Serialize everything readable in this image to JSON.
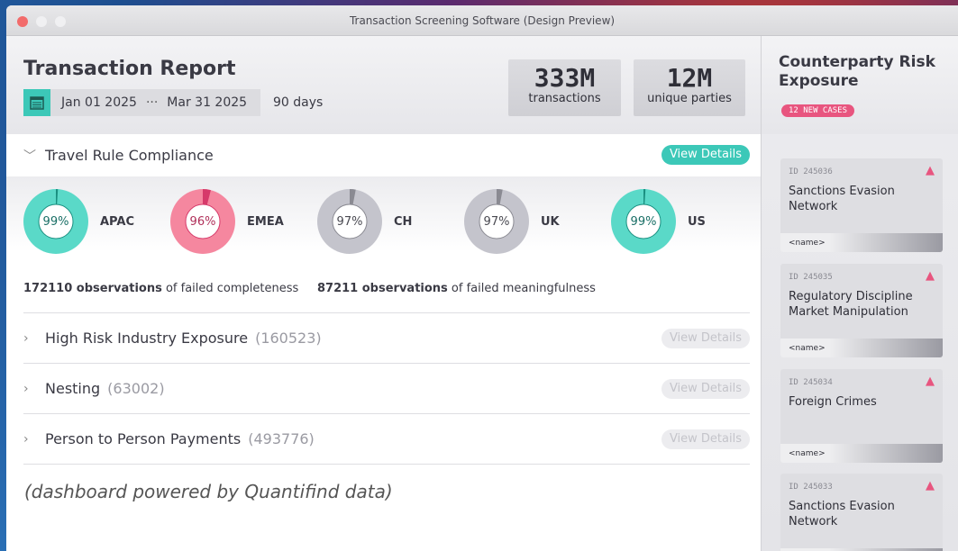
{
  "window": {
    "title": "Transaction Screening Software (Design Preview)",
    "dot_colors": [
      "#f26b6b",
      "#f0f0f2",
      "#f0f0f2"
    ]
  },
  "report": {
    "title": "Transaction Report",
    "date_start": "Jan 01 2025",
    "date_sep": "···",
    "date_end": "Mar 31 2025",
    "days": "90 days",
    "stats": [
      {
        "value": "333M",
        "label": "transactions"
      },
      {
        "value": "12M",
        "label": "unique parties"
      }
    ]
  },
  "travel": {
    "label": "Travel Rule Compliance",
    "view_label": "View Details",
    "regions": [
      {
        "name": "APAC",
        "pct": "99%",
        "value": 99,
        "fill": "#5ad9c8",
        "mark": "#1a8f80",
        "text": "#1a6f66"
      },
      {
        "name": "EMEA",
        "pct": "96%",
        "value": 96,
        "fill": "#f5879f",
        "mark": "#d63a6a",
        "text": "#b0305a"
      },
      {
        "name": "CH",
        "pct": "97%",
        "value": 97,
        "fill": "#c4c4cc",
        "mark": "#8a8a92",
        "text": "#4a4a52"
      },
      {
        "name": "UK",
        "pct": "97%",
        "value": 97,
        "fill": "#c4c4cc",
        "mark": "#8a8a92",
        "text": "#4a4a52"
      },
      {
        "name": "US",
        "pct": "99%",
        "value": 99,
        "fill": "#5ad9c8",
        "mark": "#1a8f80",
        "text": "#1a6f66"
      }
    ],
    "obs1_count": "172110 observations",
    "obs1_text": " of failed completeness",
    "obs2_count": "87211 observations",
    "obs2_text": " of failed meaningfulness"
  },
  "sections": [
    {
      "label": "High Risk Industry Exposure",
      "count": "(160523)",
      "view_label": "View Details"
    },
    {
      "label": "Nesting",
      "count": "(63002)",
      "view_label": "View Details"
    },
    {
      "label": "Person to Person Payments",
      "count": "(493776)",
      "view_label": "View Details"
    }
  ],
  "footer_note": "(dashboard powered by Quantifind data)",
  "side": {
    "title": "Counterparty Risk Exposure",
    "badge": "12 NEW CASES",
    "cards": [
      {
        "id": "ID 245036",
        "title": "Sanctions Evasion Network",
        "name": "<name>"
      },
      {
        "id": "ID 245035",
        "title": "Regulatory Discipline Market Manipulation",
        "name": "<name>"
      },
      {
        "id": "ID 245034",
        "title": "Foreign Crimes",
        "name": "<name>"
      },
      {
        "id": "ID 245033",
        "title": "Sanctions Evasion Network",
        "name": "<name>"
      }
    ]
  },
  "icons": {
    "calendar": "calendar-icon",
    "warning": "warning-icon",
    "chevron": "chevron-icon"
  }
}
